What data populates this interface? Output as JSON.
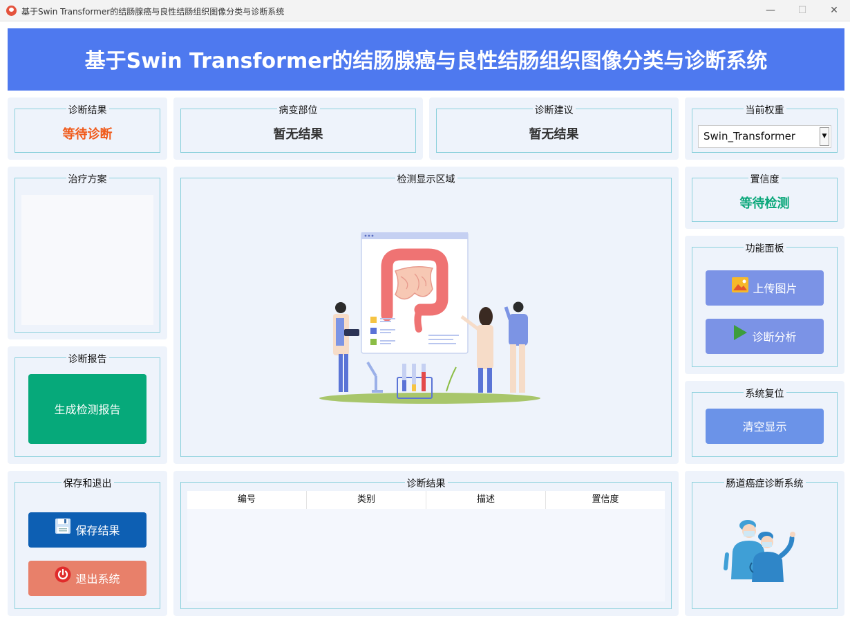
{
  "window": {
    "title": "基于Swin Transformer的结肠腺癌与良性结肠组织图像分类与诊断系统",
    "min_glyph": "—",
    "max_glyph": "☐",
    "close_glyph": "✕"
  },
  "header": {
    "title": "基于Swin Transformer的结肠腺癌与良性结肠组织图像分类与诊断系统"
  },
  "diagnosis": {
    "label": "诊断结果",
    "value": "等待诊断"
  },
  "lesion": {
    "label": "病变部位",
    "value": "暂无结果"
  },
  "advice": {
    "label": "诊断建议",
    "value": "暂无结果"
  },
  "weights": {
    "label": "当前权重",
    "selected": "Swin_Transformer"
  },
  "treatment": {
    "label": "治疗方案"
  },
  "display": {
    "label": "检测显示区域"
  },
  "confidence": {
    "label": "置信度",
    "value": "等待检测"
  },
  "functions": {
    "label": "功能面板",
    "upload": "上传图片",
    "analyze": "诊断分析"
  },
  "reset": {
    "label": "系统复位",
    "clear": "清空显示"
  },
  "report": {
    "label": "诊断报告",
    "generate": "生成检测报告"
  },
  "save_exit": {
    "label": "保存和退出",
    "save": "保存结果",
    "exit": "退出系统"
  },
  "results_table": {
    "label": "诊断结果",
    "columns": [
      "编号",
      "类别",
      "描述",
      "置信度"
    ],
    "rows": []
  },
  "brand": {
    "label": "肠道癌症诊断系统"
  },
  "colors": {
    "header": "#4e79ef",
    "accent_button": "#7b93e6",
    "report_button": "#06a97a",
    "save_button": "#0d5fb3",
    "exit_button": "#e8806a",
    "orange_text": "#f05a1a",
    "green_text": "#0aa77a"
  },
  "icons": [
    "app-icon",
    "image-upload-icon",
    "play-icon",
    "floppy-disk-icon",
    "power-icon",
    "colon-illustration",
    "doctors-illustration"
  ]
}
